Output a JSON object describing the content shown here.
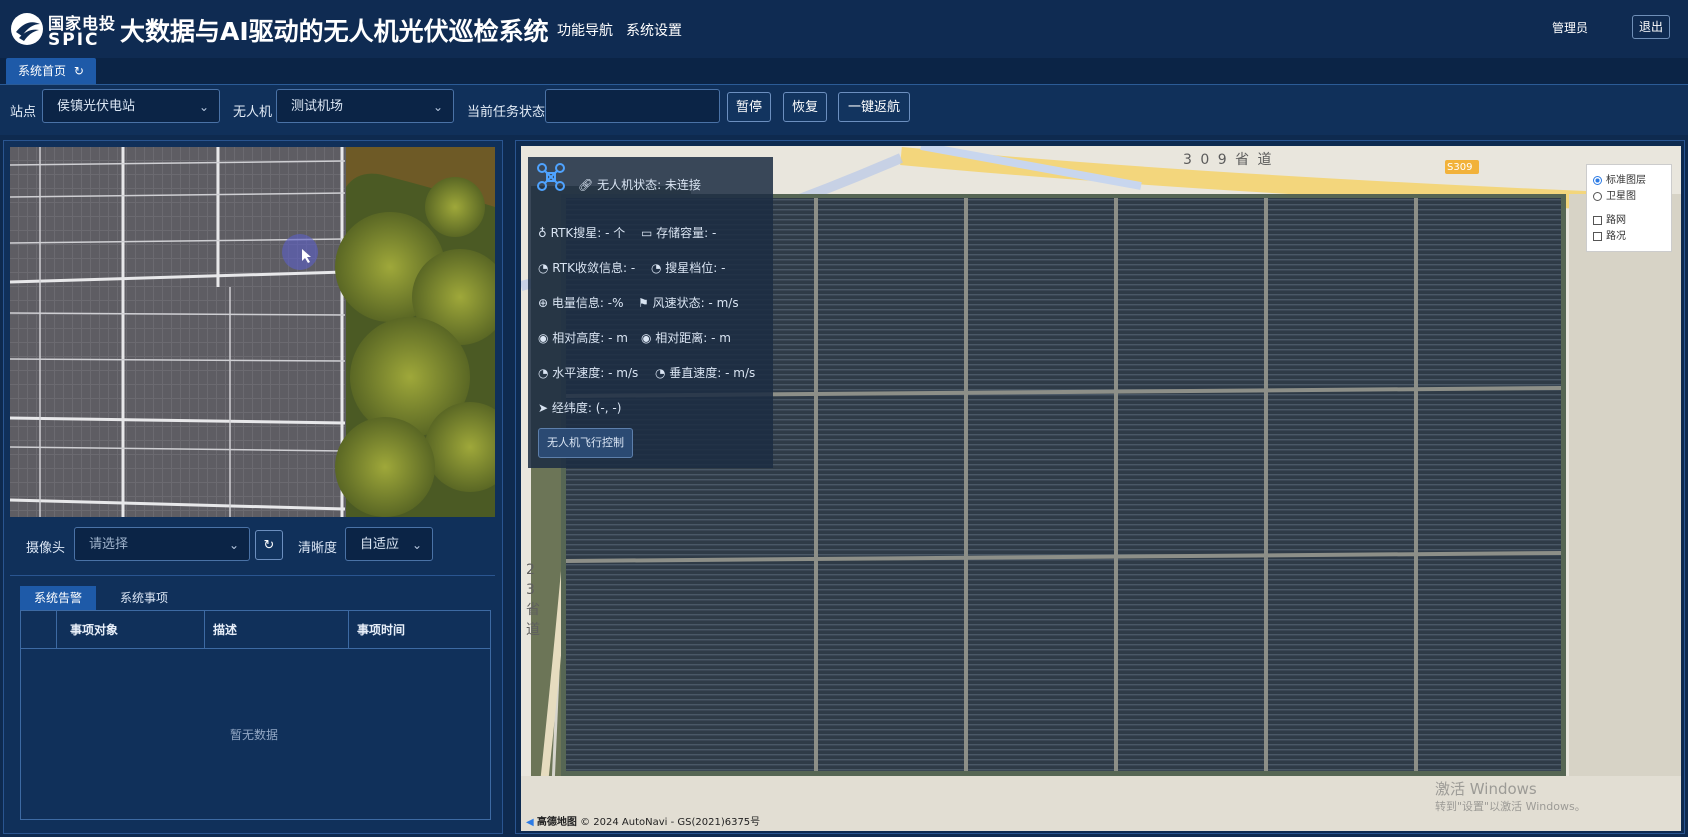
{
  "header": {
    "logo_cn": "国家电投",
    "logo_en": "SPIC",
    "title": "大数据与AI驱动的无人机光伏巡检系统",
    "nav": [
      "功能导航",
      "系统设置"
    ],
    "user": "管理员",
    "logout": "退出"
  },
  "tabs": {
    "home": "系统首页"
  },
  "toolbar": {
    "site_label": "站点",
    "site_value": "侯镇光伏电站",
    "drone_label": "无人机",
    "drone_value": "测试机场",
    "task_label": "当前任务状态",
    "task_value": "",
    "pause": "暂停",
    "resume": "恢复",
    "return_home": "一键返航"
  },
  "camera": {
    "camera_label": "摄像头",
    "camera_placeholder": "请选择",
    "clarity_label": "清晰度",
    "clarity_value": "自适应"
  },
  "alarm": {
    "tabs": [
      "系统告警",
      "系统事项"
    ],
    "columns": [
      "事项对象",
      "描述",
      "事项时间"
    ],
    "empty": "暂无数据"
  },
  "drone_status": {
    "title": "无人机状态: 未连接",
    "rows": [
      [
        "RTK搜星: - 个",
        "存储容量: -"
      ],
      [
        "RTK收敛信息: -",
        "搜星档位: -"
      ],
      [
        "电量信息: -%",
        "风速状态: - m/s"
      ],
      [
        "相对高度: - m",
        "相对距离: - m"
      ],
      [
        "水平速度: - m/s",
        "垂直速度: - m/s"
      ],
      [
        "经纬度: (-, -)",
        ""
      ]
    ],
    "control_button": "无人机飞行控制"
  },
  "map": {
    "layers": [
      "标准图层",
      "卫星图"
    ],
    "overlays": [
      "路网",
      "路况"
    ],
    "road_309": "3 0 9 省 道",
    "shield": "S309",
    "road_side": "2 3 省 道",
    "attribution_logo": "高德地图",
    "attribution": "© 2024 AutoNavi - GS(2021)6375号",
    "watermark_1": "激活 Windows",
    "watermark_2": "转到\"设置\"以激活 Windows。"
  }
}
